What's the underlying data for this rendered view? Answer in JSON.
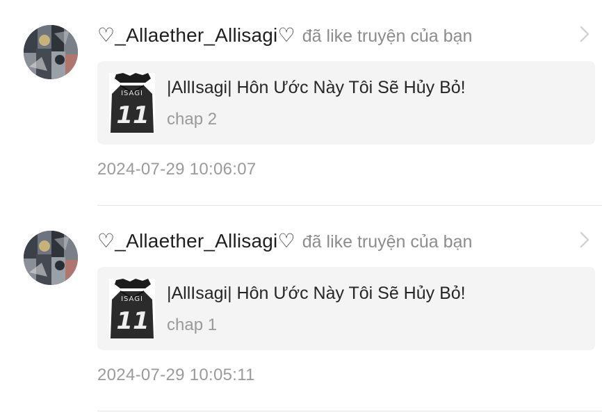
{
  "colors": {
    "username": "#1f1f1f",
    "muted": "#8c8c8c",
    "card_background": "#f4f4f5",
    "divider": "#e3e3e3"
  },
  "icons": {
    "avatar": "user-avatar-image",
    "cover": "story-cover-image",
    "chevron": "chevron-right-icon"
  },
  "notifications": [
    {
      "username": "♡_Allaether_Allisagi♡",
      "action": "đã like truyện của bạn",
      "story": {
        "title": "|AllIsagi| Hôn Ước Này Tôi Sẽ Hủy Bỏ!",
        "chapter": "chap 2",
        "cover_text": "ISAGI",
        "cover_number": "11"
      },
      "timestamp": "2024-07-29 10:06:07"
    },
    {
      "username": "♡_Allaether_Allisagi♡",
      "action": "đã like truyện của bạn",
      "story": {
        "title": "|AllIsagi| Hôn Ước Này Tôi Sẽ Hủy Bỏ!",
        "chapter": "chap 1",
        "cover_text": "ISAGI",
        "cover_number": "11"
      },
      "timestamp": "2024-07-29 10:05:11"
    }
  ]
}
